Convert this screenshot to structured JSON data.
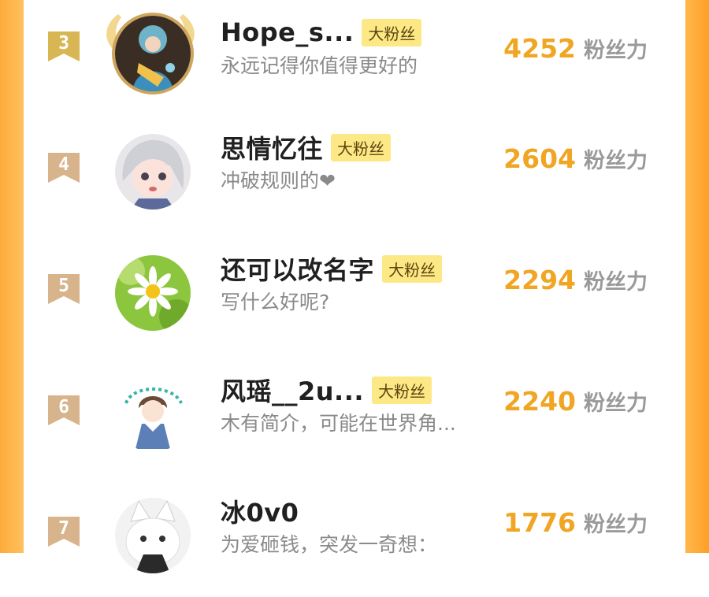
{
  "ranking": [
    {
      "rank": "3",
      "name": "Hope_s...",
      "tag": "大粉丝",
      "bio": "永远记得你值得更好的",
      "points": "4252",
      "unit": "粉丝力",
      "avatar": "anime-girl-avatar",
      "frame": "golden-crown"
    },
    {
      "rank": "4",
      "name": "思情忆往",
      "tag": "大粉丝",
      "bio": "冲破规则的❤",
      "points": "2604",
      "unit": "粉丝力",
      "avatar": "anime-white-hair-avatar"
    },
    {
      "rank": "5",
      "name": "还可以改名字",
      "tag": "大粉丝",
      "bio": "写什么好呢?",
      "points": "2294",
      "unit": "粉丝力",
      "avatar": "daisy-avatar"
    },
    {
      "rank": "6",
      "name": "风瑶__2u...",
      "tag": "大粉丝",
      "bio": "木有简介，可能在世界角...",
      "points": "2240",
      "unit": "粉丝力",
      "avatar": "anime-girl-sailor-avatar"
    },
    {
      "rank": "7",
      "name": "冰0v0",
      "tag": "",
      "bio": "为爱砸钱，突发一奇想：",
      "points": "1776",
      "unit": "粉丝力",
      "avatar": "white-cat-avatar"
    }
  ],
  "colors": {
    "accent": "#f0a523",
    "tag_bg": "#fce985",
    "badge": "#d8b48c",
    "gold_badge": "#d9b654"
  }
}
